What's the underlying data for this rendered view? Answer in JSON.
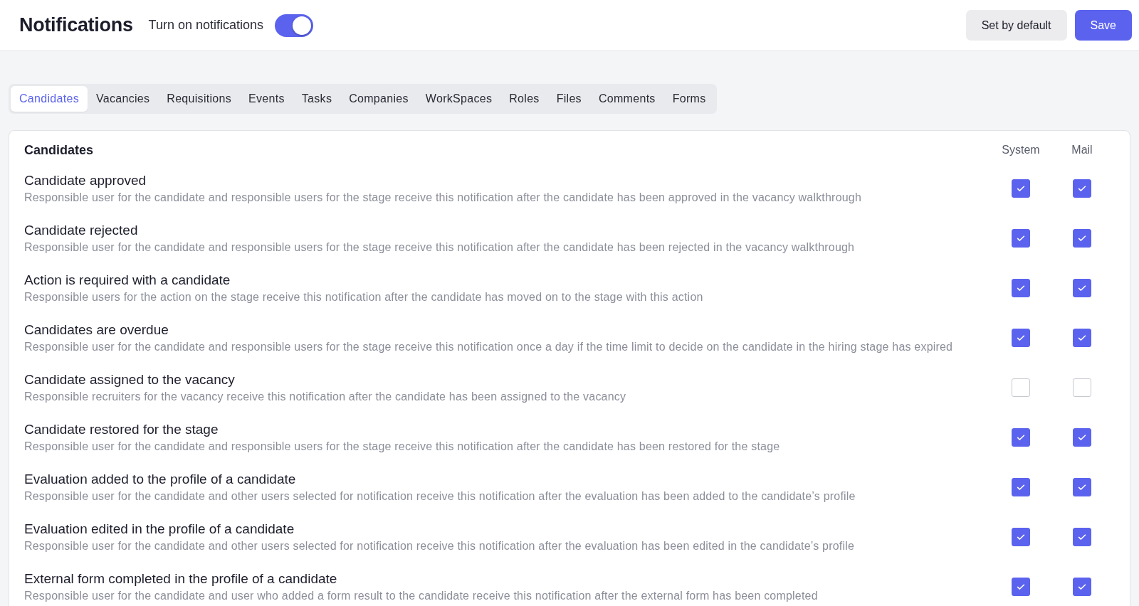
{
  "header": {
    "title": "Notifications",
    "toggle": {
      "label": "Turn on notifications",
      "on": true
    },
    "buttons": [
      {
        "label": "Set by default",
        "kind": "secondary"
      },
      {
        "label": "Save",
        "kind": "primary"
      }
    ]
  },
  "tabs": [
    {
      "label": "Candidates",
      "selected": true
    },
    {
      "label": "Vacancies",
      "selected": false
    },
    {
      "label": "Requisitions",
      "selected": false
    },
    {
      "label": "Events",
      "selected": false
    },
    {
      "label": "Tasks",
      "selected": false
    },
    {
      "label": "Companies",
      "selected": false
    },
    {
      "label": "WorkSpaces",
      "selected": false
    },
    {
      "label": "Roles",
      "selected": false
    },
    {
      "label": "Files",
      "selected": false
    },
    {
      "label": "Comments",
      "selected": false
    },
    {
      "label": "Forms",
      "selected": false
    }
  ],
  "section": {
    "title": "Candidates",
    "columns": [
      "System",
      "Mail"
    ],
    "rows": [
      {
        "title": "Candidate approved",
        "description": "Responsible user for the candidate and responsible users for the stage receive this notification after the candidate has been approved in the vacancy walkthrough",
        "system": true,
        "mail": true
      },
      {
        "title": "Candidate rejected",
        "description": "Responsible user for the candidate and responsible users for the stage receive this notification after the candidate has been rejected in the vacancy walkthrough",
        "system": true,
        "mail": true
      },
      {
        "title": "Action is required with a candidate",
        "description": "Responsible users for the action on the stage receive this notification after the candidate has moved on to the stage with this action",
        "system": true,
        "mail": true
      },
      {
        "title": "Candidates are overdue",
        "description": "Responsible user for the candidate and responsible users for the stage receive this notification once a day if the time limit to decide on the candidate in the hiring stage has expired",
        "system": true,
        "mail": true
      },
      {
        "title": "Candidate assigned to the vacancy",
        "description": "Responsible recruiters for the vacancy receive this notification after the candidate has been assigned to the vacancy",
        "system": false,
        "mail": false
      },
      {
        "title": "Candidate restored for the stage",
        "description": "Responsible user for the candidate and responsible users for the stage receive this notification after the candidate has been restored for the stage",
        "system": true,
        "mail": true
      },
      {
        "title": "Evaluation added to the profile of a candidate",
        "description": "Responsible user for the candidate and other users selected for notification receive this notification after the evaluation has been added to the candidate’s profile",
        "system": true,
        "mail": true
      },
      {
        "title": "Evaluation edited in the profile of a candidate",
        "description": "Responsible user for the candidate and other users selected for notification receive this notification after the evaluation has been edited in the candidate’s profile",
        "system": true,
        "mail": true
      },
      {
        "title": "External form completed in the profile of a candidate",
        "description": "Responsible user for the candidate and user who added a form result to the candidate receive this notification after the external form has been completed",
        "system": true,
        "mail": true
      }
    ]
  }
}
